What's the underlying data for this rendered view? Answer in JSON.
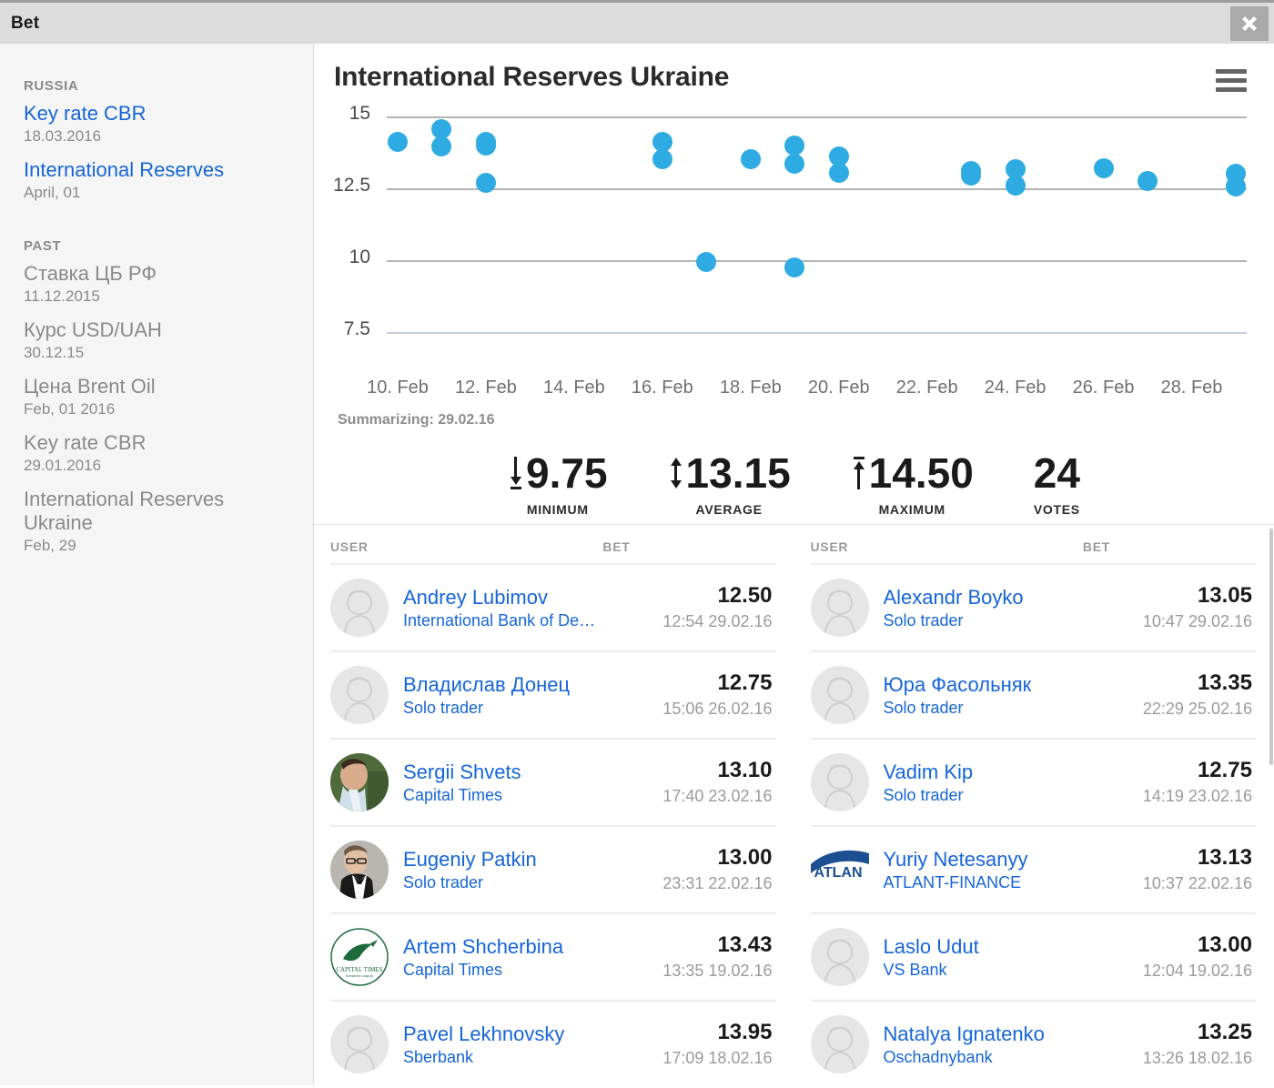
{
  "window": {
    "title": "Bet",
    "close_icon": "close-icon"
  },
  "sidebar": {
    "groups": [
      {
        "label": "RUSSIA",
        "items": [
          {
            "title": "Key rate CBR",
            "sub": "18.03.2016",
            "state": "active"
          },
          {
            "title": "International Reserves",
            "sub": "April, 01",
            "state": "active"
          }
        ]
      },
      {
        "label": "PAST",
        "items": [
          {
            "title": "Ставка ЦБ РФ",
            "sub": "11.12.2015",
            "state": "past"
          },
          {
            "title": "Курс USD/UAH",
            "sub": "30.12.15",
            "state": "past"
          },
          {
            "title": "Цена Brent Oil",
            "sub": "Feb, 01 2016",
            "state": "past"
          },
          {
            "title": "Key rate CBR",
            "sub": "29.01.2016",
            "state": "past"
          },
          {
            "title": "International Reserves Ukraine",
            "sub": "Feb, 29",
            "state": "past"
          }
        ]
      }
    ]
  },
  "chart": {
    "title": "International Reserves Ukraine",
    "menu_icon": "hamburger-menu-icon",
    "summarizing_label": "Summarizing: 29.02.16",
    "accent_color": "#2eabe2"
  },
  "chart_data": {
    "type": "scatter",
    "title": "International Reserves Ukraine",
    "xlabel": "",
    "ylabel": "",
    "ylim": [
      7.5,
      15.0
    ],
    "yticks": [
      15,
      12.5,
      10,
      7.5
    ],
    "ytick_labels": [
      "15",
      "12.5",
      "10",
      "7.5"
    ],
    "xticks": [
      "10. Feb",
      "12. Feb",
      "14. Feb",
      "16. Feb",
      "18. Feb",
      "20. Feb",
      "22. Feb",
      "24. Feb",
      "26. Feb",
      "28. Feb"
    ],
    "grid": true,
    "legend": "none",
    "points": [
      {
        "x": "10. Feb",
        "y": 14.1
      },
      {
        "x": "11. Feb",
        "y": 14.55
      },
      {
        "x": "11. Feb",
        "y": 13.95
      },
      {
        "x": "12. Feb",
        "y": 14.1
      },
      {
        "x": "12. Feb",
        "y": 14.0
      },
      {
        "x": "12. Feb",
        "y": 12.7
      },
      {
        "x": "16. Feb",
        "y": 14.1
      },
      {
        "x": "16. Feb",
        "y": 13.5
      },
      {
        "x": "18. Feb",
        "y": 13.5
      },
      {
        "x": "19. Feb",
        "y": 14.0
      },
      {
        "x": "19. Feb",
        "y": 13.35
      },
      {
        "x": "20. Feb",
        "y": 13.6
      },
      {
        "x": "20. Feb",
        "y": 13.05
      },
      {
        "x": "17. Feb",
        "y": 9.95
      },
      {
        "x": "19. Feb",
        "y": 9.75
      },
      {
        "x": "23. Feb",
        "y": 13.1
      },
      {
        "x": "23. Feb",
        "y": 12.95
      },
      {
        "x": "24. Feb",
        "y": 13.15
      },
      {
        "x": "24. Feb",
        "y": 12.6
      },
      {
        "x": "26. Feb",
        "y": 13.2
      },
      {
        "x": "27. Feb",
        "y": 12.75
      },
      {
        "x": "29. Feb",
        "y": 13.0
      },
      {
        "x": "29. Feb",
        "y": 12.55
      }
    ]
  },
  "stats": [
    {
      "value": "9.75",
      "label": "MINIMUM",
      "arrow": "arrow-down-icon"
    },
    {
      "value": "13.15",
      "label": "AVERAGE",
      "arrow": "arrow-up-down-icon"
    },
    {
      "value": "14.50",
      "label": "MAXIMUM",
      "arrow": "arrow-up-icon"
    },
    {
      "value": "24",
      "label": "VOTES",
      "arrow": "none"
    }
  ],
  "bets": {
    "headers": {
      "user": "USER",
      "bet": "BET"
    },
    "left": [
      {
        "name": "Andrey Lubimov",
        "org": "International Bank of De…",
        "value": "12.50",
        "time": "12:54 29.02.16",
        "avatar": "placeholder"
      },
      {
        "name": "Владислав Донец",
        "org": "Solo trader",
        "value": "12.75",
        "time": "15:06 26.02.16",
        "avatar": "placeholder"
      },
      {
        "name": "Sergii Shvets",
        "org": "Capital Times",
        "value": "13.10",
        "time": "17:40 23.02.16",
        "avatar": "photo-a"
      },
      {
        "name": "Eugeniy Patkin",
        "org": "Solo trader",
        "value": "13.00",
        "time": "23:31 22.02.16",
        "avatar": "photo-b"
      },
      {
        "name": "Artem Shcherbina",
        "org": "Capital Times",
        "value": "13.43",
        "time": "13:35 19.02.16",
        "avatar": "logo-ct"
      },
      {
        "name": "Pavel Lekhnovsky",
        "org": "Sberbank",
        "value": "13.95",
        "time": "17:09 18.02.16",
        "avatar": "placeholder"
      }
    ],
    "right": [
      {
        "name": "Alexandr Boyko",
        "org": "Solo trader",
        "value": "13.05",
        "time": "10:47 29.02.16",
        "avatar": "placeholder"
      },
      {
        "name": "Юра Фасольняк",
        "org": "Solo trader",
        "value": "13.35",
        "time": "22:29 25.02.16",
        "avatar": "placeholder"
      },
      {
        "name": "Vadim Kip",
        "org": "Solo trader",
        "value": "12.75",
        "time": "14:19 23.02.16",
        "avatar": "placeholder"
      },
      {
        "name": "Yuriy Netesanyy",
        "org": "ATLANT-FINANCE",
        "value": "13.13",
        "time": "10:37 22.02.16",
        "avatar": "logo-atlant"
      },
      {
        "name": "Laslo Udut",
        "org": "VS Bank",
        "value": "13.00",
        "time": "12:04 19.02.16",
        "avatar": "placeholder"
      },
      {
        "name": "Natalya Ignatenko",
        "org": "Oschadnybank",
        "value": "13.25",
        "time": "13:26 18.02.16",
        "avatar": "placeholder"
      }
    ]
  }
}
